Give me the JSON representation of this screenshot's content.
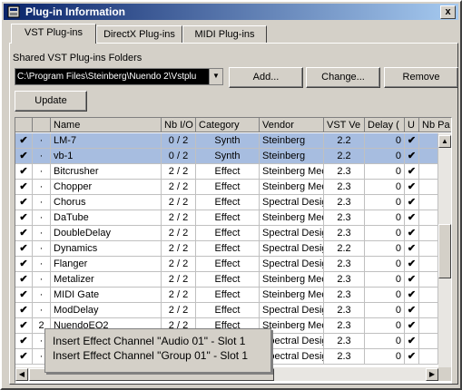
{
  "window": {
    "title": "Plug-in Information",
    "close_glyph": "x"
  },
  "tabs": [
    {
      "label": "VST Plug-ins",
      "active": true
    },
    {
      "label": "DirectX Plug-ins",
      "active": false
    },
    {
      "label": "MIDI Plug-ins",
      "active": false
    }
  ],
  "folders": {
    "label": "Shared VST Plug-ins Folders",
    "path": "C:\\Program Files\\Steinberg\\Nuendo 2\\Vstplu"
  },
  "buttons": {
    "add": "Add...",
    "change": "Change...",
    "remove": "Remove",
    "update": "Update"
  },
  "table": {
    "columns": [
      "",
      "",
      "Name",
      "Nb I/O",
      "Category",
      "Vendor",
      "VST Ve",
      "Delay (",
      "U",
      "Nb Pa"
    ],
    "rows": [
      {
        "active": "✔",
        "inst": "·",
        "name": "LM-7",
        "io": "0 / 2",
        "category": "Synth",
        "vendor": "Steinberg",
        "version": "2.2",
        "delay": "0",
        "u": "✔",
        "selected": true
      },
      {
        "active": "✔",
        "inst": "·",
        "name": "vb-1",
        "io": "0 / 2",
        "category": "Synth",
        "vendor": "Steinberg",
        "version": "2.2",
        "delay": "0",
        "u": "✔",
        "selected": true
      },
      {
        "active": "✔",
        "inst": "·",
        "name": "Bitcrusher",
        "io": "2 / 2",
        "category": "Effect",
        "vendor": "Steinberg Med",
        "version": "2.3",
        "delay": "0",
        "u": "✔",
        "selected": false
      },
      {
        "active": "✔",
        "inst": "·",
        "name": "Chopper",
        "io": "2 / 2",
        "category": "Effect",
        "vendor": "Steinberg Med",
        "version": "2.3",
        "delay": "0",
        "u": "✔",
        "selected": false
      },
      {
        "active": "✔",
        "inst": "·",
        "name": "Chorus",
        "io": "2 / 2",
        "category": "Effect",
        "vendor": "Spectral Desig",
        "version": "2.3",
        "delay": "0",
        "u": "✔",
        "selected": false
      },
      {
        "active": "✔",
        "inst": "·",
        "name": "DaTube",
        "io": "2 / 2",
        "category": "Effect",
        "vendor": "Steinberg Med",
        "version": "2.3",
        "delay": "0",
        "u": "✔",
        "selected": false
      },
      {
        "active": "✔",
        "inst": "·",
        "name": "DoubleDelay",
        "io": "2 / 2",
        "category": "Effect",
        "vendor": "Spectral Desig",
        "version": "2.3",
        "delay": "0",
        "u": "✔",
        "selected": false
      },
      {
        "active": "✔",
        "inst": "·",
        "name": "Dynamics",
        "io": "2 / 2",
        "category": "Effect",
        "vendor": "Spectral Desig",
        "version": "2.2",
        "delay": "0",
        "u": "✔",
        "selected": false
      },
      {
        "active": "✔",
        "inst": "·",
        "name": "Flanger",
        "io": "2 / 2",
        "category": "Effect",
        "vendor": "Spectral Desig",
        "version": "2.3",
        "delay": "0",
        "u": "✔",
        "selected": false
      },
      {
        "active": "✔",
        "inst": "·",
        "name": "Metalizer",
        "io": "2 / 2",
        "category": "Effect",
        "vendor": "Steinberg Med",
        "version": "2.3",
        "delay": "0",
        "u": "✔",
        "selected": false
      },
      {
        "active": "✔",
        "inst": "·",
        "name": "MIDI Gate",
        "io": "2 / 2",
        "category": "Effect",
        "vendor": "Steinberg Med",
        "version": "2.3",
        "delay": "0",
        "u": "✔",
        "selected": false
      },
      {
        "active": "✔",
        "inst": "·",
        "name": "ModDelay",
        "io": "2 / 2",
        "category": "Effect",
        "vendor": "Spectral Desig",
        "version": "2.3",
        "delay": "0",
        "u": "✔",
        "selected": false
      },
      {
        "active": "✔",
        "inst": "2",
        "name": "NuendoEQ2",
        "io": "2 / 2",
        "category": "Effect",
        "vendor": "Steinberg Med",
        "version": "2.3",
        "delay": "0",
        "u": "✔",
        "selected": false
      },
      {
        "active": "✔",
        "inst": "·",
        "name": "",
        "io": "",
        "category": "",
        "vendor": "Spectral Desig",
        "version": "2.3",
        "delay": "0",
        "u": "✔",
        "selected": false
      },
      {
        "active": "✔",
        "inst": "·",
        "name": "",
        "io": "",
        "category": "",
        "vendor": "Spectral Desig",
        "version": "2.3",
        "delay": "0",
        "u": "✔",
        "selected": false
      }
    ]
  },
  "tooltip": {
    "lines": [
      "Insert Effect Channel \"Audio 01\" - Slot 1",
      "Insert Effect Channel \"Group 01\" - Slot 1"
    ]
  },
  "icons": {
    "app": "plugin-info-icon",
    "check": "checkmark-icon"
  }
}
